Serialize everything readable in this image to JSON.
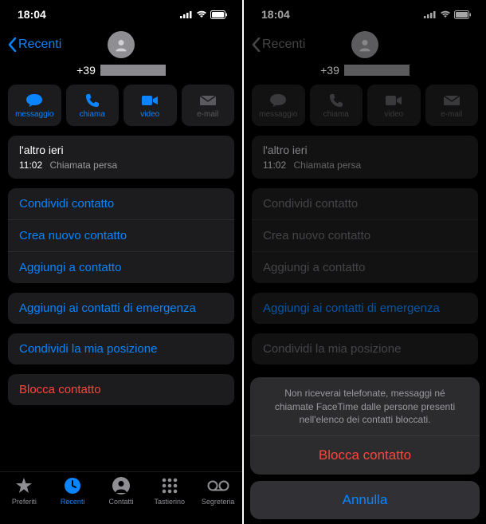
{
  "status": {
    "time": "18:04"
  },
  "nav": {
    "back": "Recenti"
  },
  "contact": {
    "prefix": "+39"
  },
  "actions": {
    "message": "messaggio",
    "call": "chiama",
    "video": "video",
    "email": "e-mail"
  },
  "callHistory": {
    "day": "l'altro ieri",
    "time": "11:02",
    "type": "Chiamata persa"
  },
  "menu1": {
    "share": "Condividi contatto",
    "new": "Crea nuovo contatto",
    "add": "Aggiungi a contatto"
  },
  "menu2": {
    "emergency": "Aggiungi ai contatti di emergenza"
  },
  "menu3": {
    "location": "Condividi la mia posizione"
  },
  "menu4": {
    "block": "Blocca contatto"
  },
  "tabs": {
    "fav": "Preferiti",
    "recent": "Recenti",
    "contacts": "Contatti",
    "keypad": "Tastierino",
    "voicemail": "Segreteria"
  },
  "sheet": {
    "info": "Non riceverai telefonate, messaggi né chiamate FaceTime dalle persone presenti nell'elenco dei contatti bloccati.",
    "block": "Blocca contatto",
    "cancel": "Annulla"
  }
}
